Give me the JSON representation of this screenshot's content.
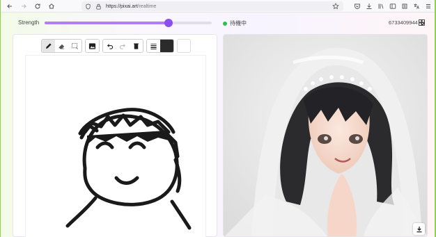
{
  "browser": {
    "url_host": "https://pixai.art",
    "url_path": "/realtime"
  },
  "controls": {
    "strength_label": "Strength",
    "strength_value": 0.74,
    "status_text": "待機中",
    "user_id": "6733409944"
  },
  "colors": {
    "accent": "#8b4ff0",
    "accent_light": "#b07ff5",
    "status_ok": "#2fbf4a"
  },
  "toolbar": {
    "tools": [
      "pen-icon",
      "eraser-icon",
      "select-icon",
      "image-icon",
      "undo-icon",
      "redo-icon",
      "trash-icon",
      "line-width-icon"
    ]
  }
}
